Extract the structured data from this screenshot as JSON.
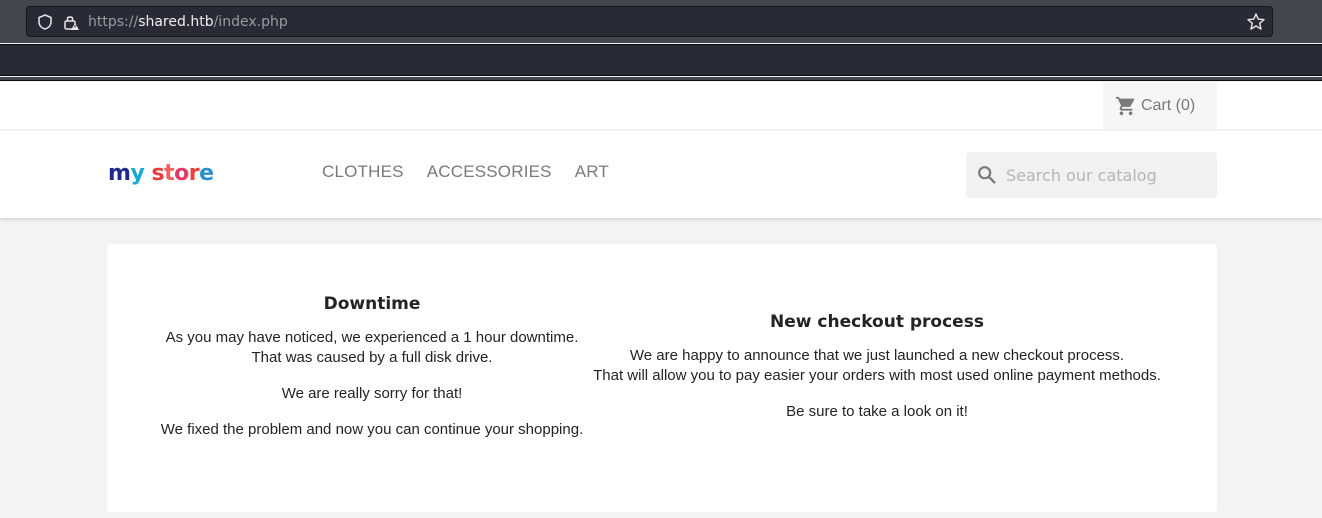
{
  "browser": {
    "url_scheme": "https://",
    "url_host": "shared.htb",
    "url_path": "/index.php"
  },
  "header": {
    "cart_label": "Cart (0)",
    "logo_text": "my store",
    "nav": [
      "CLOTHES",
      "ACCESSORIES",
      "ART"
    ],
    "search_placeholder": "Search our catalog"
  },
  "content": {
    "downtime": {
      "title": "Downtime",
      "para1_line1": "As you may have noticed, we experienced a 1 hour downtime.",
      "para1_line2": "That was caused by a full disk drive.",
      "para2": "We are really sorry for that!",
      "para3": "We fixed the problem and now you can continue your shopping."
    },
    "checkout": {
      "title": "New checkout process",
      "para1_line1": "We are happy to announce that we just launched a new checkout process.",
      "para1_line2": "That will allow you to pay easier your orders with most used online payment methods.",
      "para2": "Be sure to take a look on it!"
    }
  }
}
